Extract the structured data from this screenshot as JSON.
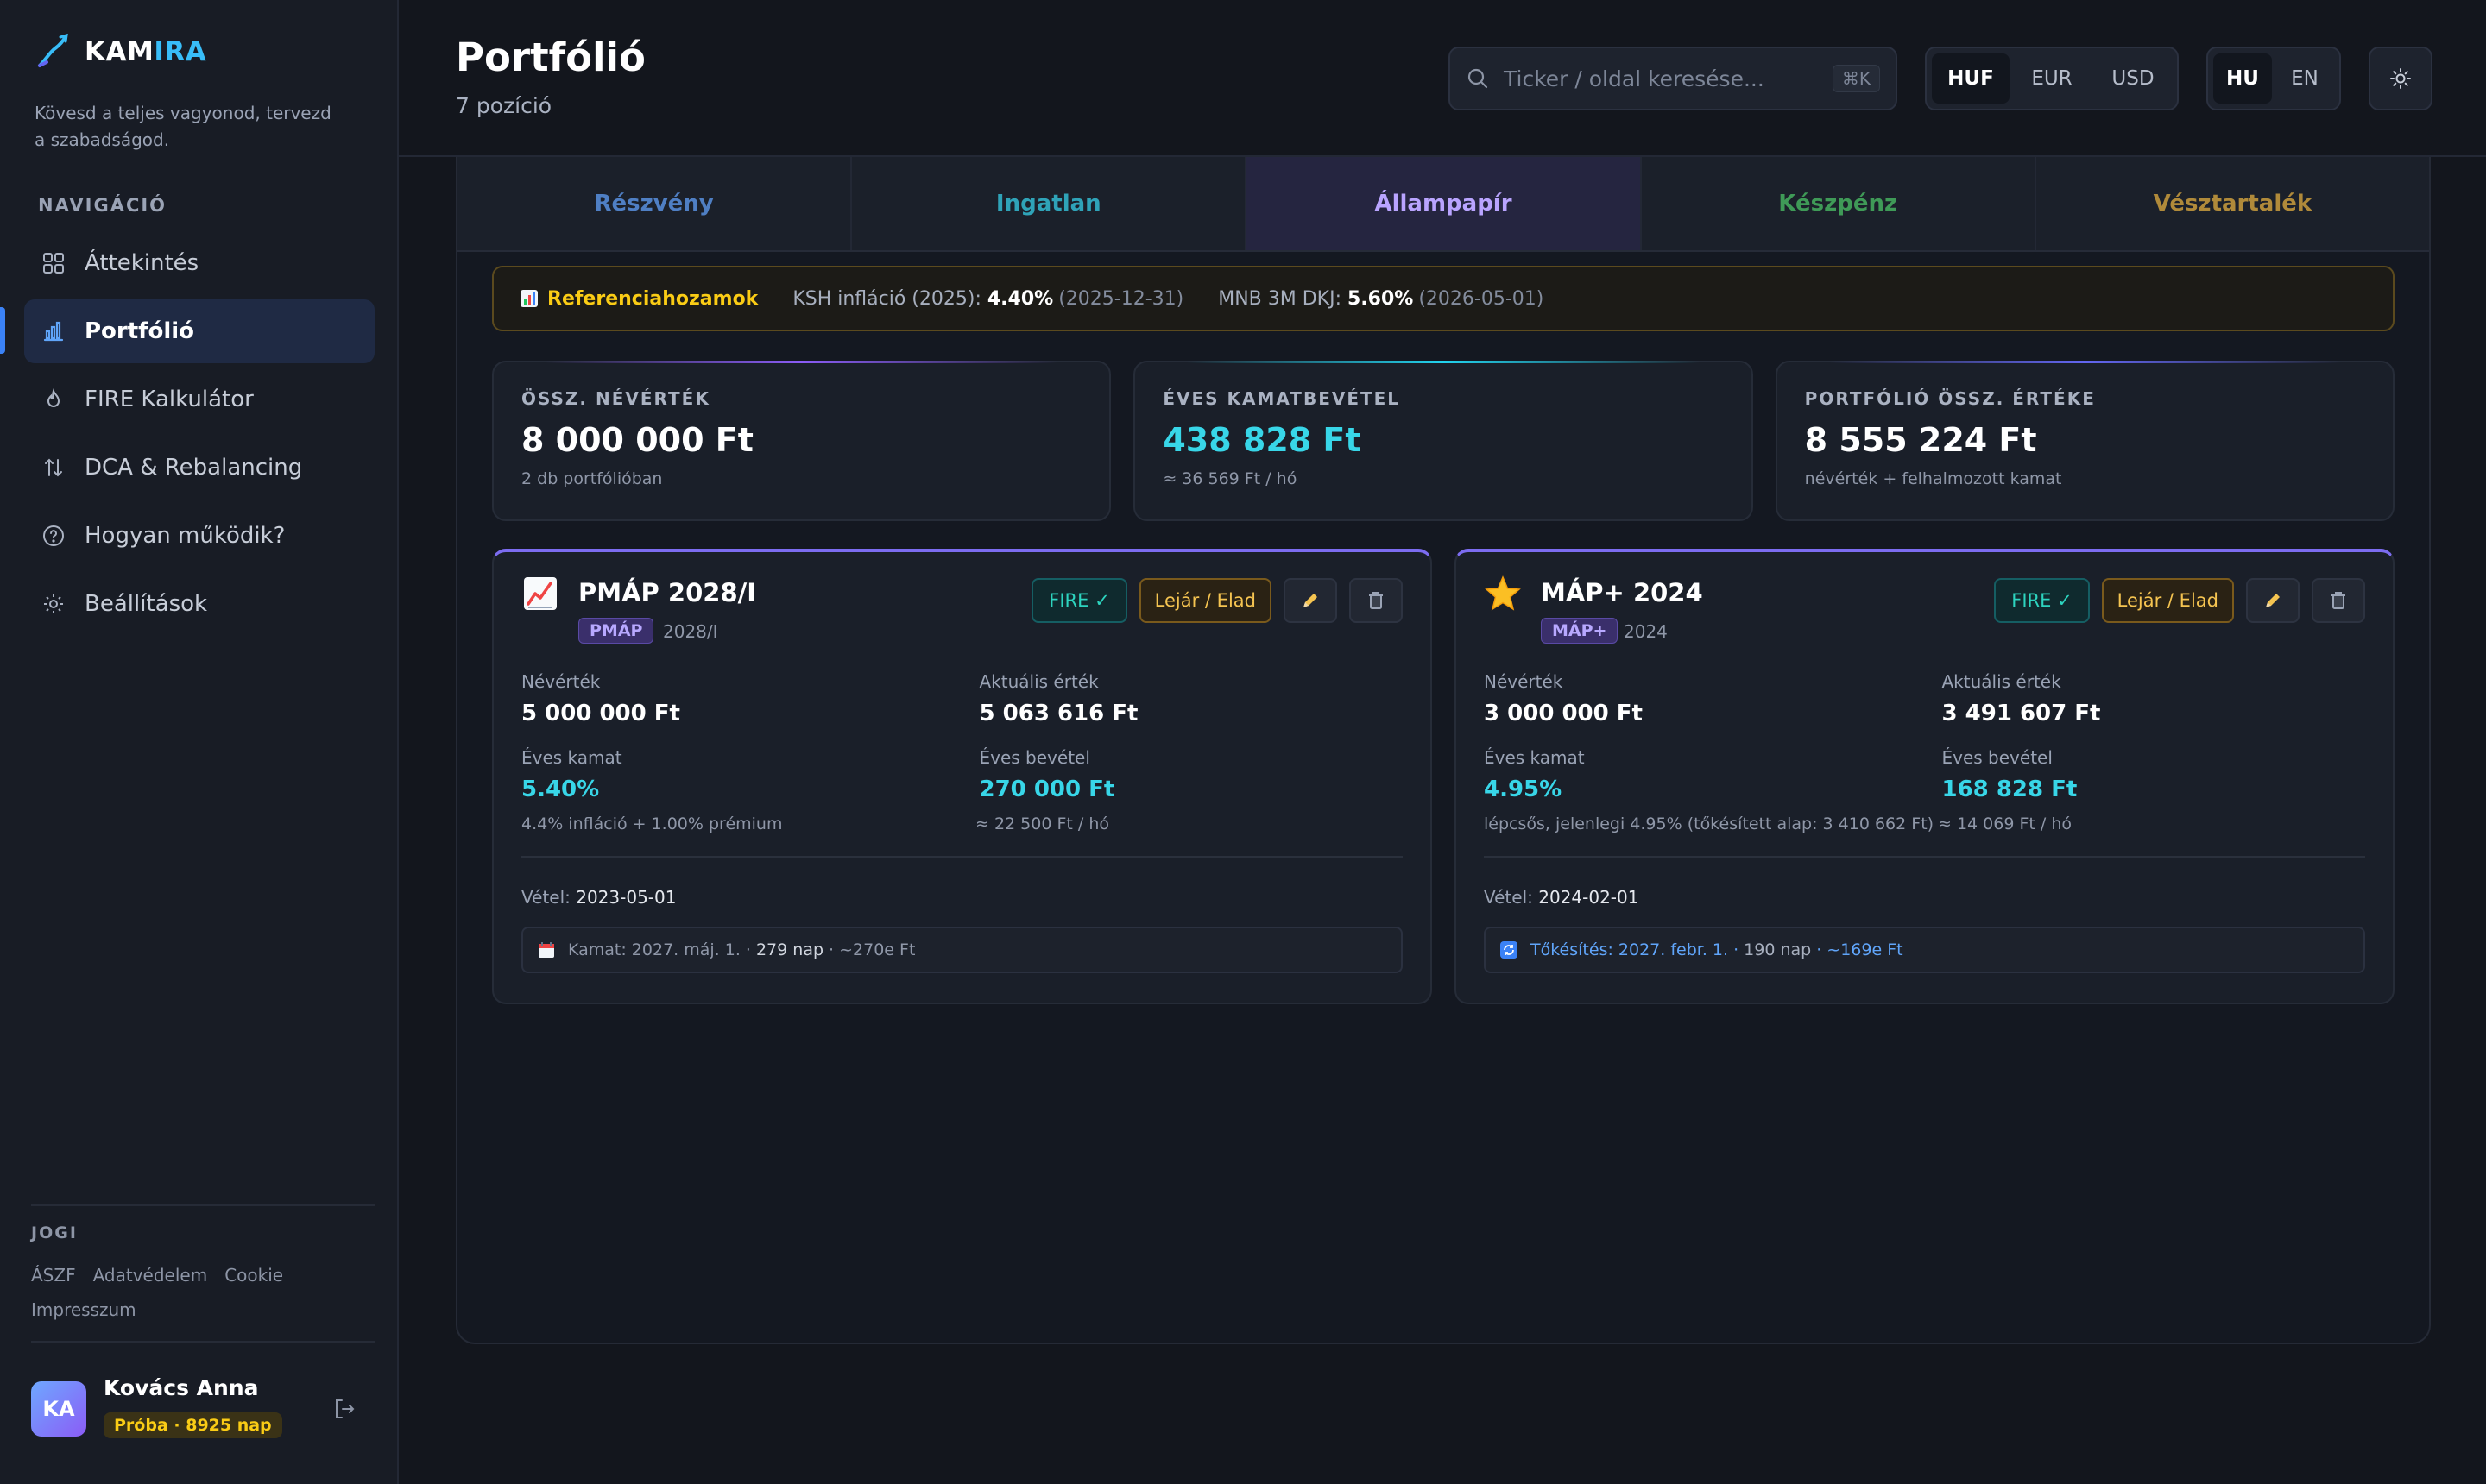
{
  "brand": {
    "name_a": "KAM",
    "name_b": "IRA",
    "tagline": "Kövesd a teljes vagyonod, tervezd a szabadságod."
  },
  "sidebar": {
    "nav_title": "NAVIGÁCIÓ",
    "items": [
      {
        "label": "Áttekintés",
        "icon": "grid-icon"
      },
      {
        "label": "Portfólió",
        "icon": "bar-chart-icon",
        "active": true
      },
      {
        "label": "FIRE Kalkulátor",
        "icon": "flame-icon"
      },
      {
        "label": "DCA & Rebalancing",
        "icon": "arrows-updown-icon"
      },
      {
        "label": "Hogyan működik?",
        "icon": "help-circle-icon"
      },
      {
        "label": "Beállítások",
        "icon": "gear-icon"
      }
    ],
    "legal_title": "JOGI",
    "legal_links": [
      "ÁSZF",
      "Adatvédelem",
      "Cookie",
      "Impresszum"
    ],
    "user": {
      "initials": "KA",
      "name": "Kovács Anna",
      "badge": "Próba · 8925 nap"
    }
  },
  "header": {
    "title": "Portfólió",
    "subtitle": "7 pozíció",
    "search_placeholder": "Ticker / oldal keresése...",
    "search_shortcut": "⌘K",
    "currencies": [
      "HUF",
      "EUR",
      "USD"
    ],
    "currency_selected": "HUF",
    "languages": [
      "HU",
      "EN"
    ],
    "language_selected": "HU"
  },
  "tabs": [
    {
      "label": "Részvény",
      "color": "#4f7fc4"
    },
    {
      "label": "Ingatlan",
      "color": "#2fa3b8"
    },
    {
      "label": "Állampapír",
      "color": "#b9a4ff",
      "active": true
    },
    {
      "label": "Készpénz",
      "color": "#3f9a57"
    },
    {
      "label": "Vésztartalék",
      "color": "#b08a3a"
    }
  ],
  "reference": {
    "title": "Referenciahozamok",
    "ksh_label": "KSH infláció (2025):",
    "ksh_value": "4.40%",
    "ksh_date": "(2025-12-31)",
    "mnb_label": "MNB 3M DKJ:",
    "mnb_value": "5.60%",
    "mnb_date": "(2026-05-01)"
  },
  "stats": [
    {
      "label": "ÖSSZ. NÉVÉRTÉK",
      "value": "8 000 000 Ft",
      "sub": "2 db portfólióban",
      "accent": "#8b5cf6"
    },
    {
      "label": "ÉVES KAMATBEVÉTEL",
      "value": "438 828 Ft",
      "sub": "≈ 36 569 Ft / hó",
      "accent": "#22d3ee"
    },
    {
      "label": "PORTFÓLIÓ ÖSSZ. ÉRTÉKE",
      "value": "8 555 224 Ft",
      "sub": "névérték + felhalmozott kamat",
      "accent": "#6366f1"
    }
  ],
  "bonds": [
    {
      "title": "PMÁP 2028/I",
      "tag": "PMÁP",
      "tag_year": "2028/I",
      "fire_label": "FIRE ✓",
      "sell_label": "Lejár / Elad",
      "face_label": "Névérték",
      "face_value": "5 000 000 Ft",
      "current_label": "Aktuális érték",
      "current_value": "5 063 616 Ft",
      "rate_label": "Éves kamat",
      "rate_value": "5.40%",
      "rate_note": "4.4% infláció + 1.00% prémium",
      "income_label": "Éves bevétel",
      "income_value": "270 000 Ft",
      "income_note": "≈ 22 500 Ft / hó",
      "purchase_label": "Vétel:",
      "purchase_date": "2023-05-01",
      "info_prefix": "Kamat: 2027. máj. 1. ·",
      "info_days": "279 nap",
      "info_suffix": "· ~270e Ft"
    },
    {
      "title": "MÁP+ 2024",
      "tag": "MÁP+",
      "tag_year": "2024",
      "fire_label": "FIRE ✓",
      "sell_label": "Lejár / Elad",
      "face_label": "Névérték",
      "face_value": "3 000 000 Ft",
      "current_label": "Aktuális érték",
      "current_value": "3 491 607 Ft",
      "rate_label": "Éves kamat",
      "rate_value": "4.95%",
      "rate_note": "lépcsős, jelenlegi 4.95% (tőkésített alap: 3 410 662 Ft)",
      "income_label": "Éves bevétel",
      "income_value": "168 828 Ft",
      "income_note": "≈ 14 069 Ft / hó",
      "purchase_label": "Vétel:",
      "purchase_date": "2024-02-01",
      "info_prefix": "Tőkésítés: 2027. febr. 1. ·",
      "info_days": "190 nap",
      "info_suffix": "· ~169e Ft"
    }
  ]
}
